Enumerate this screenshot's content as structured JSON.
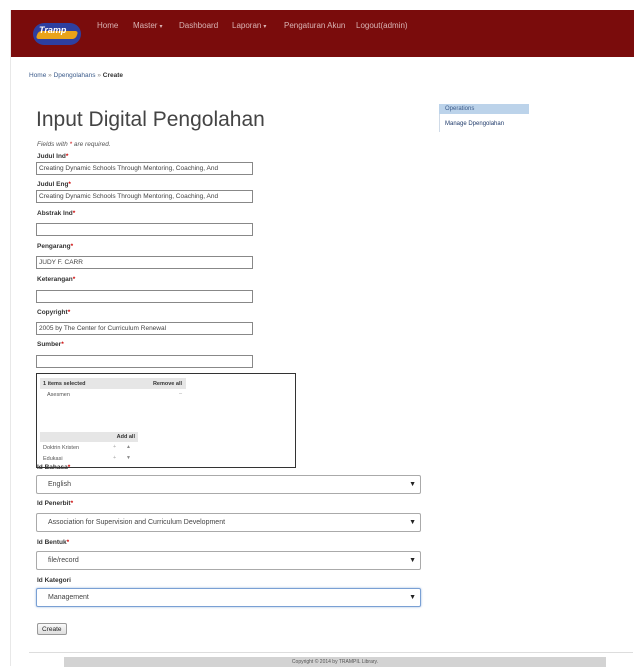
{
  "navbar": {
    "logo_text": "Tramp",
    "items": [
      {
        "label": "Home",
        "dropdown": false
      },
      {
        "label": "Master",
        "dropdown": true
      },
      {
        "label": "Dashboard",
        "dropdown": false
      },
      {
        "label": "Laporan",
        "dropdown": true
      },
      {
        "label": "Pengaturan Akun",
        "dropdown": false
      },
      {
        "label": "Logout(admin)",
        "dropdown": false
      }
    ],
    "caret": "▾",
    "bg_color": "#7a0c0c"
  },
  "breadcrumb": {
    "home": "Home",
    "sep": "»",
    "parent": "Dpengolahans",
    "current": "Create"
  },
  "page_title": "Input Digital Pengolahan",
  "required_note": {
    "before": "Fields with ",
    "star": "*",
    "after": " are required."
  },
  "required_star": "*",
  "fields": {
    "judul_ind": {
      "label": "Judul Ind",
      "value": "Creating Dynamic Schools Through Mentoring, Coaching, And"
    },
    "judul_eng": {
      "label": "Judul Eng",
      "value": "Creating Dynamic Schools Through Mentoring, Coaching, And"
    },
    "abstrak_ind": {
      "label": "Abstrak Ind",
      "value": ""
    },
    "pengarang": {
      "label": "Pengarang",
      "value": "JUDY F. CARR"
    },
    "keterangan": {
      "label": "Keterangan",
      "value": ""
    },
    "copyright": {
      "label": "Copyright",
      "value": "2005 by The Center for Curriculum Renewal"
    },
    "sumber": {
      "label": "Sumber",
      "value": ""
    }
  },
  "multiselect": {
    "selected_header": "1 items selected",
    "remove_all": "Remove all",
    "selected_items": [
      {
        "label": "Asesmen",
        "action": "–"
      }
    ],
    "add_all": "Add all",
    "available_items": [
      {
        "label": "Doktrin Kristen"
      },
      {
        "label": "Edukasi"
      }
    ],
    "plus": "+"
  },
  "selects": {
    "id_bahasa": {
      "label": "Id Bahasa",
      "value": "English",
      "required": true
    },
    "id_penerbit": {
      "label": "Id Penerbit",
      "value": "Association for Supervision and Curriculum Development",
      "required": true
    },
    "id_bentuk": {
      "label": "Id Bentuk",
      "value": "file/record",
      "required": true
    },
    "id_kategori": {
      "label": "Id Kategori",
      "value": "Management",
      "required": false
    }
  },
  "select_arrow": "▼",
  "create_button": "Create",
  "sidebar": {
    "heading": "Operations",
    "links": [
      "Manage Dpengolahan"
    ]
  },
  "footer": "Copyright © 2014 by TRAMPIL Library."
}
